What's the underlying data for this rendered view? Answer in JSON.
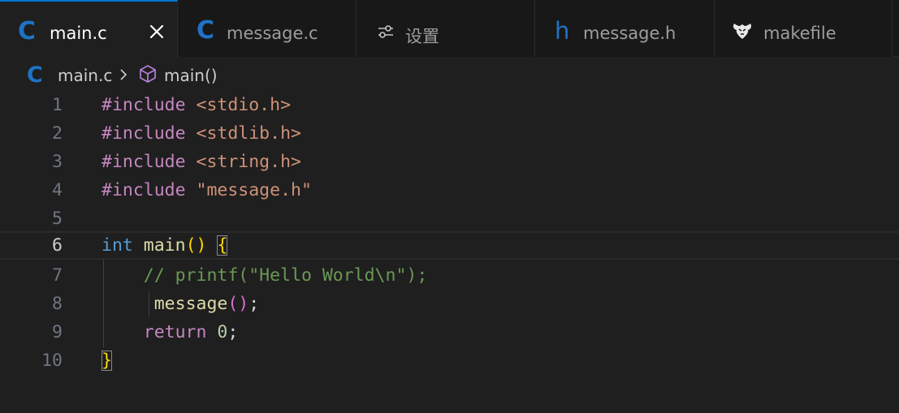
{
  "colors": {
    "accent": "#0078d4",
    "c_icon": "#1e73c6",
    "preprocessor": "#c586c0",
    "string": "#ce9178",
    "type_keyword": "#569cd6",
    "function": "#dcdcaa",
    "bracket_level1": "#ffd700",
    "bracket_level2": "#da70d6",
    "comment": "#6a9955",
    "number": "#b5cea8"
  },
  "tabs": [
    {
      "label": "main.c",
      "icon": "c-language-icon",
      "active": true
    },
    {
      "label": "message.c",
      "icon": "c-language-icon",
      "active": false
    },
    {
      "label": "设置",
      "icon": "settings-sliders-icon",
      "active": false
    },
    {
      "label": "message.h",
      "icon": "h-header-icon",
      "active": false
    },
    {
      "label": "makefile",
      "icon": "makefile-gnu-icon",
      "active": false
    }
  ],
  "breadcrumb": {
    "file": "main.c",
    "file_icon": "c-language-icon",
    "separator_icon": "chevron-right-icon",
    "symbol": "main()",
    "symbol_icon": "symbol-method-icon"
  },
  "editor": {
    "active_line": 6,
    "line_numbers": [
      "1",
      "2",
      "3",
      "4",
      "5",
      "6",
      "7",
      "8",
      "9",
      "10"
    ],
    "lines": {
      "l1": {
        "directive": "#include",
        "target": "<stdio.h>"
      },
      "l2": {
        "directive": "#include",
        "target": "<stdlib.h>"
      },
      "l3": {
        "directive": "#include",
        "target": "<string.h>"
      },
      "l4": {
        "directive": "#include",
        "target": "\"message.h\""
      },
      "l6": {
        "type": "int",
        "name": "main",
        "parens": "()",
        "open_brace": "{"
      },
      "l7": {
        "comment": "// printf(\"Hello World\\n\");"
      },
      "l8": {
        "call": "message",
        "parens": "()",
        "semicolon": ";"
      },
      "l9": {
        "keyword": "return",
        "value": "0",
        "semicolon": ";"
      },
      "l10": {
        "close_brace": "}"
      }
    }
  }
}
